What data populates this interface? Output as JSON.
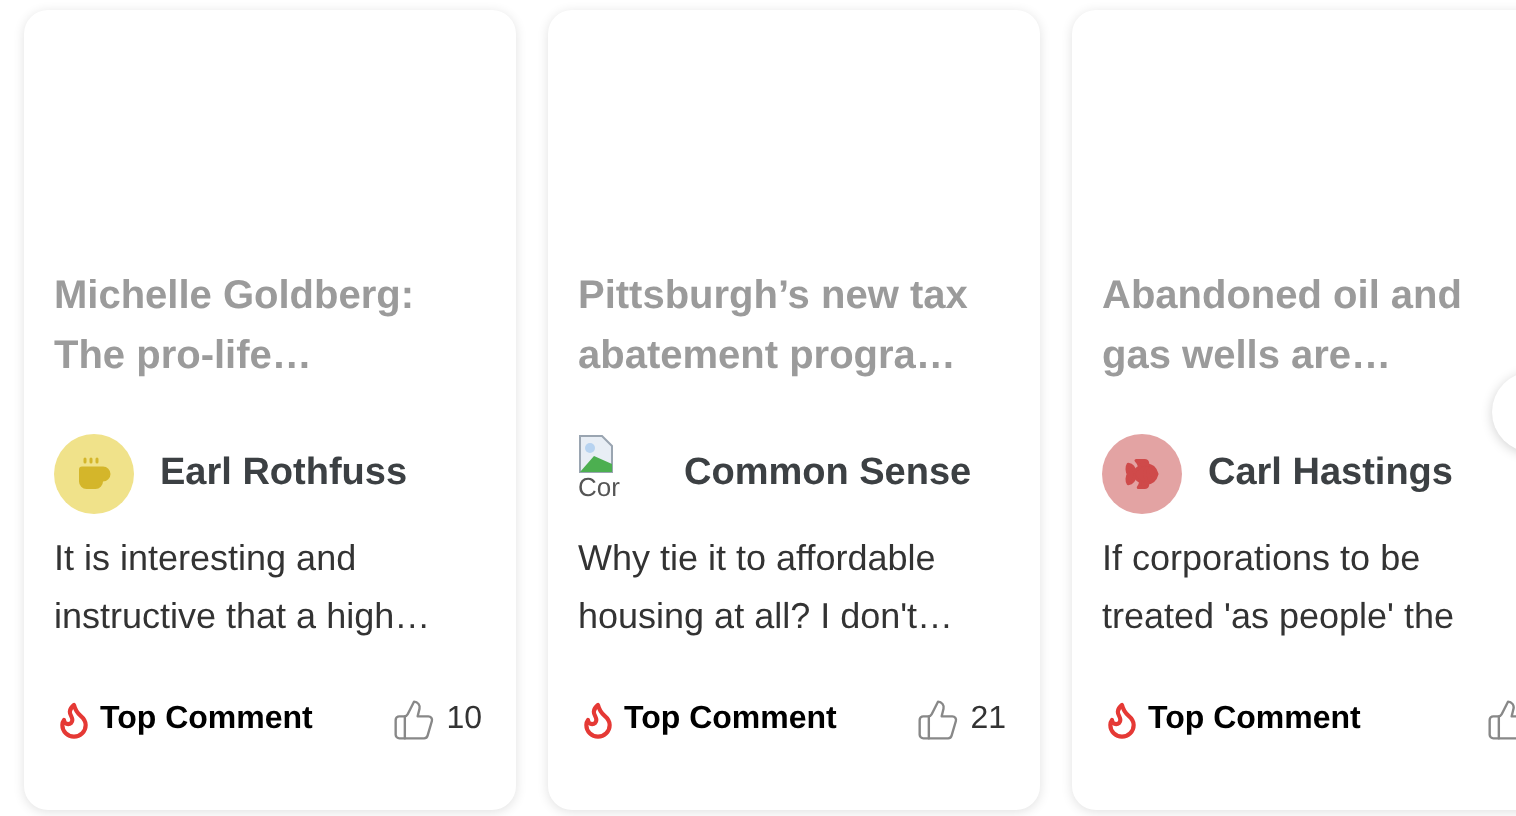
{
  "cards": [
    {
      "title": "Michelle Goldberg: The pro-life…",
      "author": "Earl Rothfuss",
      "avatar": {
        "kind": "icon",
        "color": "#f0e28a"
      },
      "comment": "It is interesting and instructive that a high…",
      "badge": "Top Comment",
      "likes": "10"
    },
    {
      "title": "Pittsburgh’s new tax abatement progra…",
      "author": "Common Sense",
      "avatar": {
        "kind": "broken",
        "alt": "Cor"
      },
      "comment": "Why tie it to affordable housing at all? I don't…",
      "badge": "Top Comment",
      "likes": "21"
    },
    {
      "title": "Abandoned oil and gas wells are…",
      "author": "Carl Hastings",
      "avatar": {
        "kind": "icon",
        "color": "#e3a3a3"
      },
      "comment": "If corporations to be treated 'as people' the",
      "badge": "Top Comment"
    }
  ]
}
